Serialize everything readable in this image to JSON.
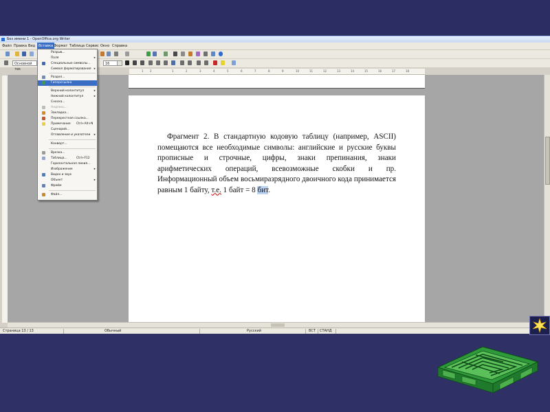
{
  "window": {
    "title": "Без имени 1 - OpenOffice.org Writer"
  },
  "menubar": [
    {
      "label": "Файл"
    },
    {
      "label": "Правка"
    },
    {
      "label": "Вид"
    },
    {
      "label": "Вставка",
      "active": true
    },
    {
      "label": "Формат"
    },
    {
      "label": "Таблица"
    },
    {
      "label": "Сервис"
    },
    {
      "label": "Окно"
    },
    {
      "label": "Справка"
    }
  ],
  "formatting": {
    "style_value": "Основной тек",
    "size_value": "16"
  },
  "ruler": {
    "ticks": [
      "1",
      "2",
      "1",
      "2",
      "3",
      "4",
      "5",
      "6",
      "7",
      "8",
      "9",
      "10",
      "11",
      "12",
      "13",
      "14",
      "15",
      "16",
      "17",
      "18"
    ]
  },
  "insert_menu": {
    "items": [
      {
        "label": "Разрыв...",
        "icon": "none"
      },
      {
        "label": "Поля",
        "submenu": true,
        "icon": "none"
      },
      {
        "label": "Специальные символы...",
        "icon": "omega-icon"
      },
      {
        "label": "Символ форматирования",
        "submenu": true,
        "icon": "none"
      },
      {
        "label": "Раздел...",
        "icon": "section-icon"
      },
      {
        "label": "Гиперссылка",
        "icon": "hyperlink-icon",
        "highlighted": true
      },
      {
        "label": "Верхний колонтитул",
        "submenu": true,
        "icon": "none"
      },
      {
        "label": "Нижний колонтитул",
        "submenu": true,
        "icon": "none"
      },
      {
        "label": "Сноска...",
        "icon": "none"
      },
      {
        "label": "Надпись...",
        "icon": "caption-icon",
        "disabled": true
      },
      {
        "label": "Закладка...",
        "icon": "bookmark-icon"
      },
      {
        "label": "Перекрестная ссылка...",
        "icon": "crossref-icon"
      },
      {
        "label": "Примечание",
        "shortcut": "Ctrl+Alt+N",
        "icon": "note-icon"
      },
      {
        "label": "Сценарий...",
        "icon": "none"
      },
      {
        "label": "Оглавление и указатели",
        "submenu": true,
        "icon": "none"
      },
      {
        "label": "Конверт...",
        "icon": "none"
      },
      {
        "label": "Врезка...",
        "icon": "frame-icon"
      },
      {
        "label": "Таблица...",
        "shortcut": "Ctrl+F12",
        "icon": "table-icon"
      },
      {
        "label": "Горизонтальная линия...",
        "icon": "none"
      },
      {
        "label": "Изображение",
        "submenu": true,
        "icon": "image-icon"
      },
      {
        "label": "Видео и звук",
        "icon": "media-icon"
      },
      {
        "label": "Объект",
        "submenu": true,
        "icon": "none"
      },
      {
        "label": "Фрейм",
        "icon": "floating-frame-icon"
      },
      {
        "label": "Файл...",
        "icon": "file-icon"
      }
    ]
  },
  "document": {
    "paragraph": {
      "text_before_link": "Фрагмент 2. В стандартную кодовую таблицу (например, ASCII) помещаются все необходимые символы: английские и русские буквы прописные и строчные, цифры, знаки препинания, знаки арифметических операций, всевозможные скобки и пр. Информационный объем восьмиразрядного двоичного кода принимается равным 1 байту, ",
      "underlined": "т.е.",
      "middle": " 1 байт = 8 ",
      "selected": "бит",
      "end": "."
    }
  },
  "statusbar": {
    "page": "Страница 13 / 13",
    "style": "Обычный",
    "language": "Русский",
    "insert_mode": "ВСТ",
    "selection_mode": "СТАНД"
  },
  "colors": {
    "slide_background": "#2f3066",
    "menu_highlight": "#3a6ec4",
    "maze_green": "#2e9a3a"
  }
}
